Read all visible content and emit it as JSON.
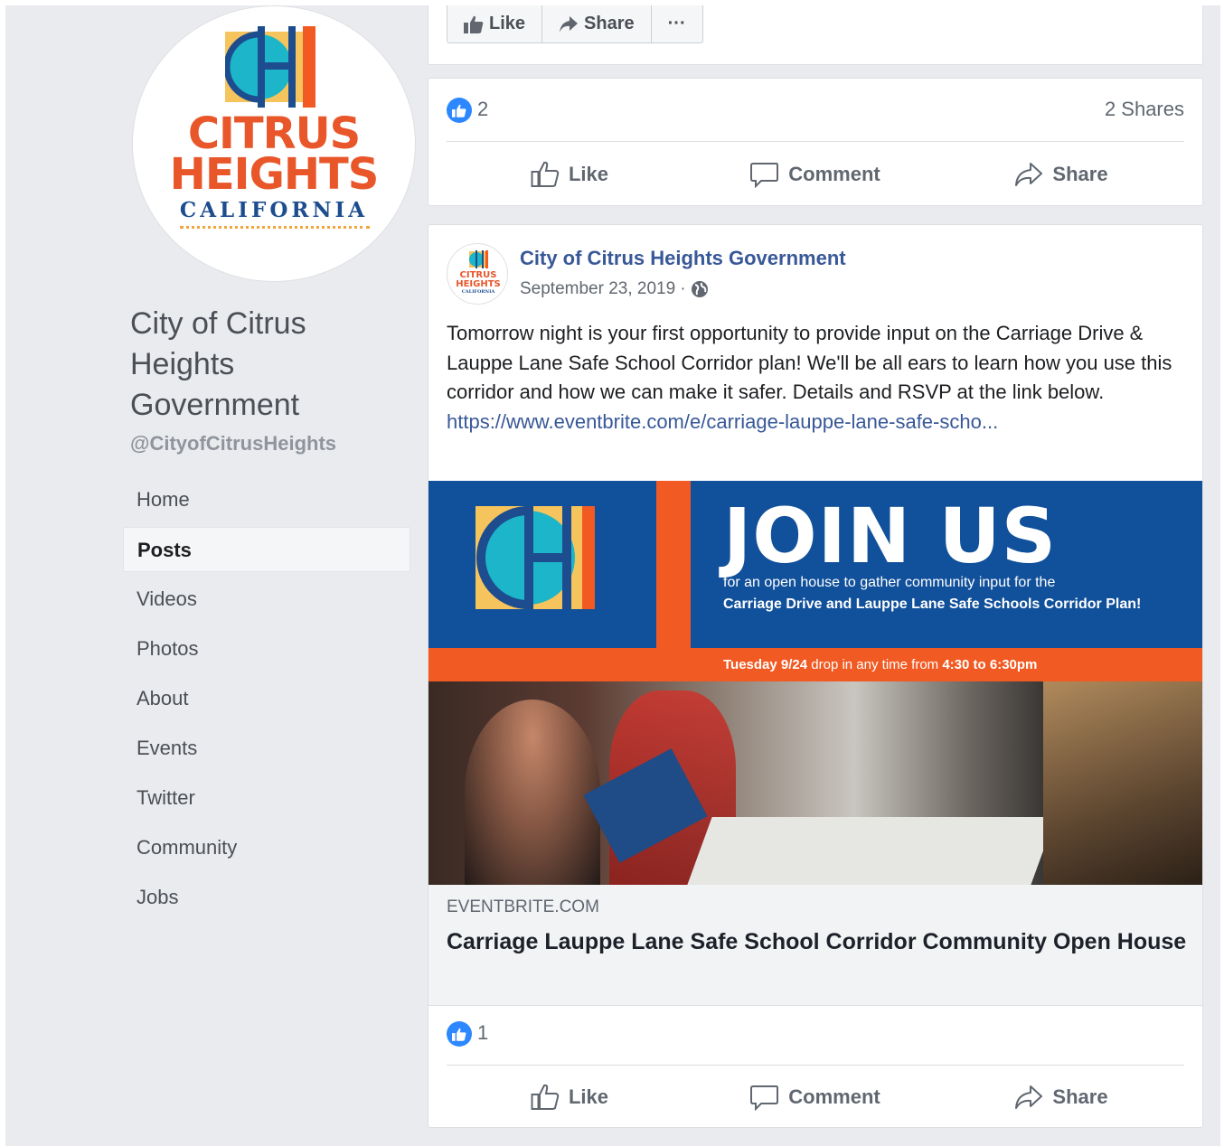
{
  "page": {
    "name": "City of Citrus Heights Government",
    "handle": "@CityofCitrusHeights",
    "logo": {
      "line1": "CITRUS",
      "line2": "HEIGHTS",
      "line3": "CALIFORNIA"
    }
  },
  "nav": {
    "items": [
      {
        "label": "Home"
      },
      {
        "label": "Posts",
        "active": true
      },
      {
        "label": "Videos"
      },
      {
        "label": "Photos"
      },
      {
        "label": "About"
      },
      {
        "label": "Events"
      },
      {
        "label": "Twitter"
      },
      {
        "label": "Community"
      },
      {
        "label": "Jobs"
      }
    ]
  },
  "top_actions": {
    "like": "Like",
    "share": "Share",
    "more": "···"
  },
  "prev_post": {
    "like_count": "2",
    "shares": "2 Shares",
    "actions": {
      "like": "Like",
      "comment": "Comment",
      "share": "Share"
    }
  },
  "post": {
    "author": "City of Citrus Heights Government",
    "date": "September 23, 2019",
    "separator": "·",
    "text": "Tomorrow night is your first opportunity to provide input on the Carriage Drive & Lauppe Lane Safe School Corridor plan! We'll be all ears to learn how you use this corridor and how we can make it safer. Details and RSVP at the link below. ",
    "link_text": "https://www.eventbrite.com/e/carriage-lauppe-lane-safe-scho...",
    "hero": {
      "headline": "JOIN US",
      "sub1": "for an open house to gather community input for the",
      "sub2": "Carriage Drive and Lauppe Lane Safe Schools Corridor Plan!",
      "date_bold1": "Tuesday 9/24",
      "date_mid": " drop in any time from ",
      "date_bold2": "4:30 to 6:30pm"
    },
    "link_preview": {
      "domain": "EVENTBRITE.COM",
      "title": "Carriage Lauppe Lane Safe School Corridor Community Open House"
    },
    "like_count": "1",
    "actions": {
      "like": "Like",
      "comment": "Comment",
      "share": "Share"
    }
  },
  "colors": {
    "fb_blue": "#385898",
    "like_blue": "#2d88ff",
    "brand_orange": "#e8562a",
    "brand_navy": "#1d4d8f",
    "hero_blue": "#11509a",
    "hero_orange": "#f15a22"
  },
  "icons": [
    "like-thumb-icon",
    "share-arrow-icon",
    "more-dots-icon",
    "comment-bubble-icon",
    "globe-icon",
    "like-badge-icon"
  ]
}
